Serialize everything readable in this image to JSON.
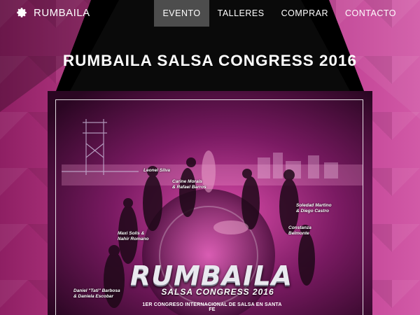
{
  "brand": {
    "name": "RUMBAILA",
    "icon": "gear-icon"
  },
  "nav": {
    "items": [
      {
        "label": "EVENTO",
        "active": true
      },
      {
        "label": "TALLERES",
        "active": false
      },
      {
        "label": "COMPRAR",
        "active": false
      },
      {
        "label": "CONTACTO",
        "active": false
      }
    ]
  },
  "page": {
    "title": "RUMBAILA SALSA CONGRESS 2016"
  },
  "poster": {
    "logo": "RUMBAILA",
    "subtitle": "SALSA CONGRESS 2016",
    "tagline": "1ER CONGRESO INTERNACIONAL DE SALSA EN SANTA FE",
    "dancers": [
      "Leonel Silva",
      "Carine Morais\n& Rafael Barros",
      "Soledad Martino\n& Diego Castro",
      "Maxi Solis &\nNahir Romano",
      "Constanza\nBelmonte",
      "Daniel \"Tati\" Barbosa\n& Daniela Escobar"
    ]
  },
  "colors": {
    "background": "#b0307f",
    "nav_active": "#4d4d4d",
    "text": "#ffffff"
  }
}
